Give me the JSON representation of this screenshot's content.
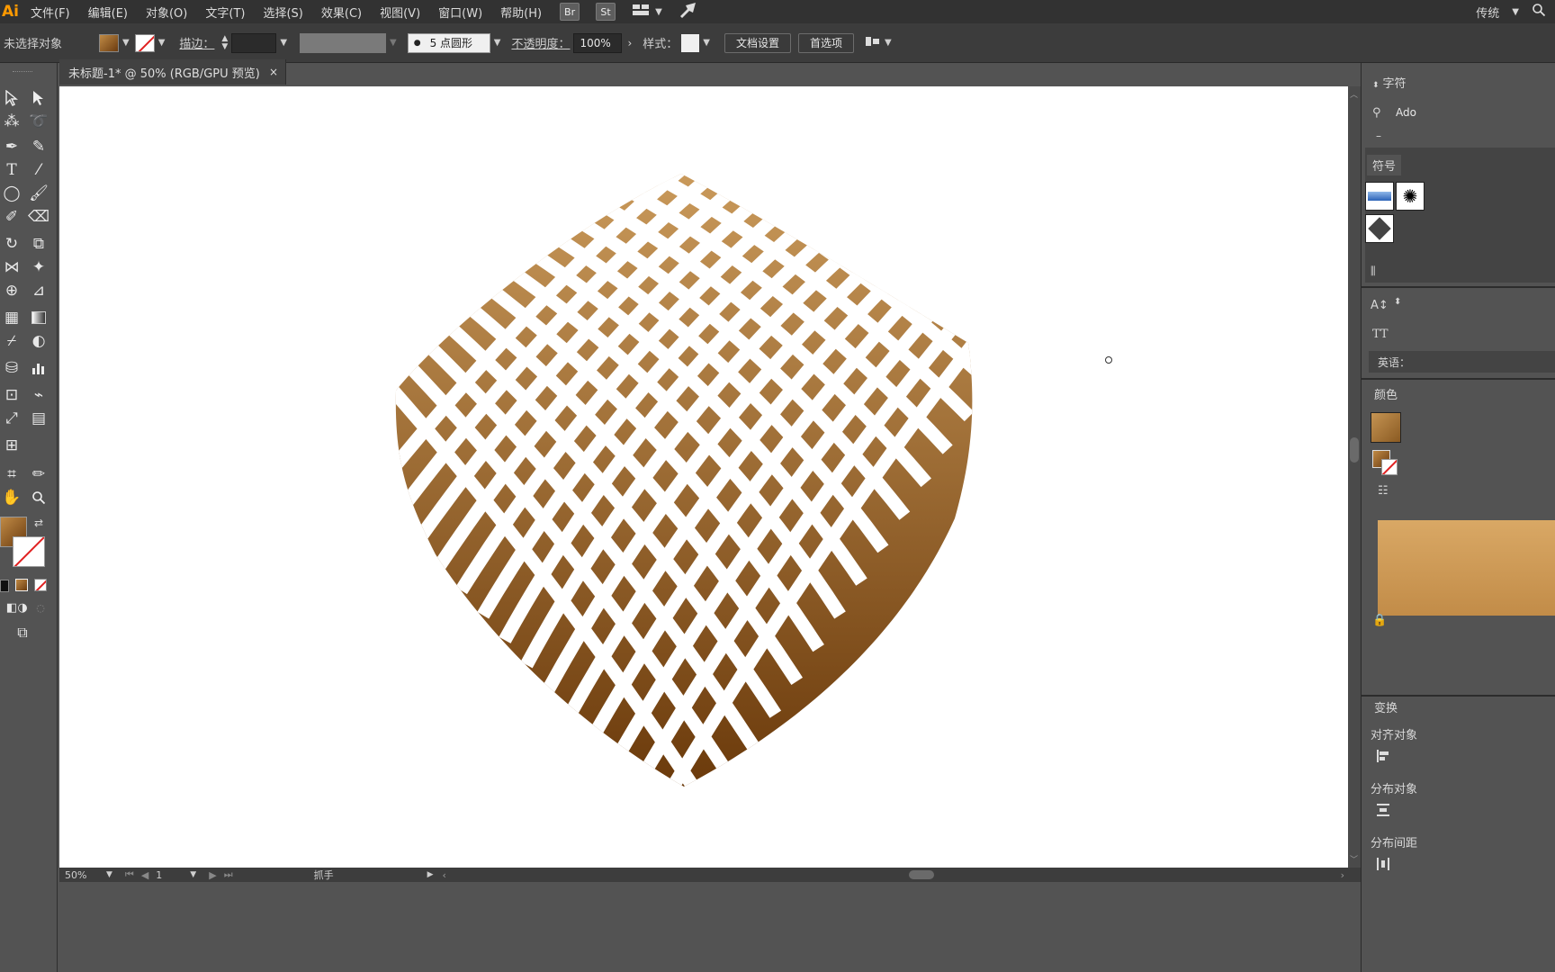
{
  "app": {
    "logo": "Ai",
    "menu": [
      "文件(F)",
      "编辑(E)",
      "对象(O)",
      "文字(T)",
      "选择(S)",
      "效果(C)",
      "视图(V)",
      "窗口(W)",
      "帮助(H)"
    ],
    "bridge_label": "Br",
    "stock_label": "St",
    "workspace_label": "传统"
  },
  "control_bar": {
    "selection_label": "未选择对象",
    "stroke_label": "描边：",
    "brush_label": "5 点圆形",
    "opacity_label": "不透明度：",
    "opacity_value": "100%",
    "style_label": "样式：",
    "doc_setup_button": "文档设置",
    "prefs_button": "首选项"
  },
  "document": {
    "tab_title": "未标题-1* @ 50% (RGB/GPU 预览)",
    "close_glyph": "×"
  },
  "status_bar": {
    "zoom": "50%",
    "artboard": "1",
    "tool": "抓手"
  },
  "right_panel": {
    "char_title": "字符",
    "char_search": "Ado",
    "char_dash": "–",
    "symbols_title": "符号",
    "language_label": "英语：",
    "color_title": "颜色",
    "transform_title": "变换",
    "align_objects_label": "对齐对象",
    "distribute_objects_label": "分布对象",
    "distribute_spacing_label": "分布间距",
    "tt_label": "TT"
  },
  "colors": {
    "fill_light": "#c59453",
    "fill_dark": "#6a380c",
    "accent_orange": "#ff9a00"
  },
  "artwork": {
    "name": "spherical-diamond-grid",
    "gradient_top": "#c9995a",
    "gradient_bottom": "#6b3a0b"
  }
}
